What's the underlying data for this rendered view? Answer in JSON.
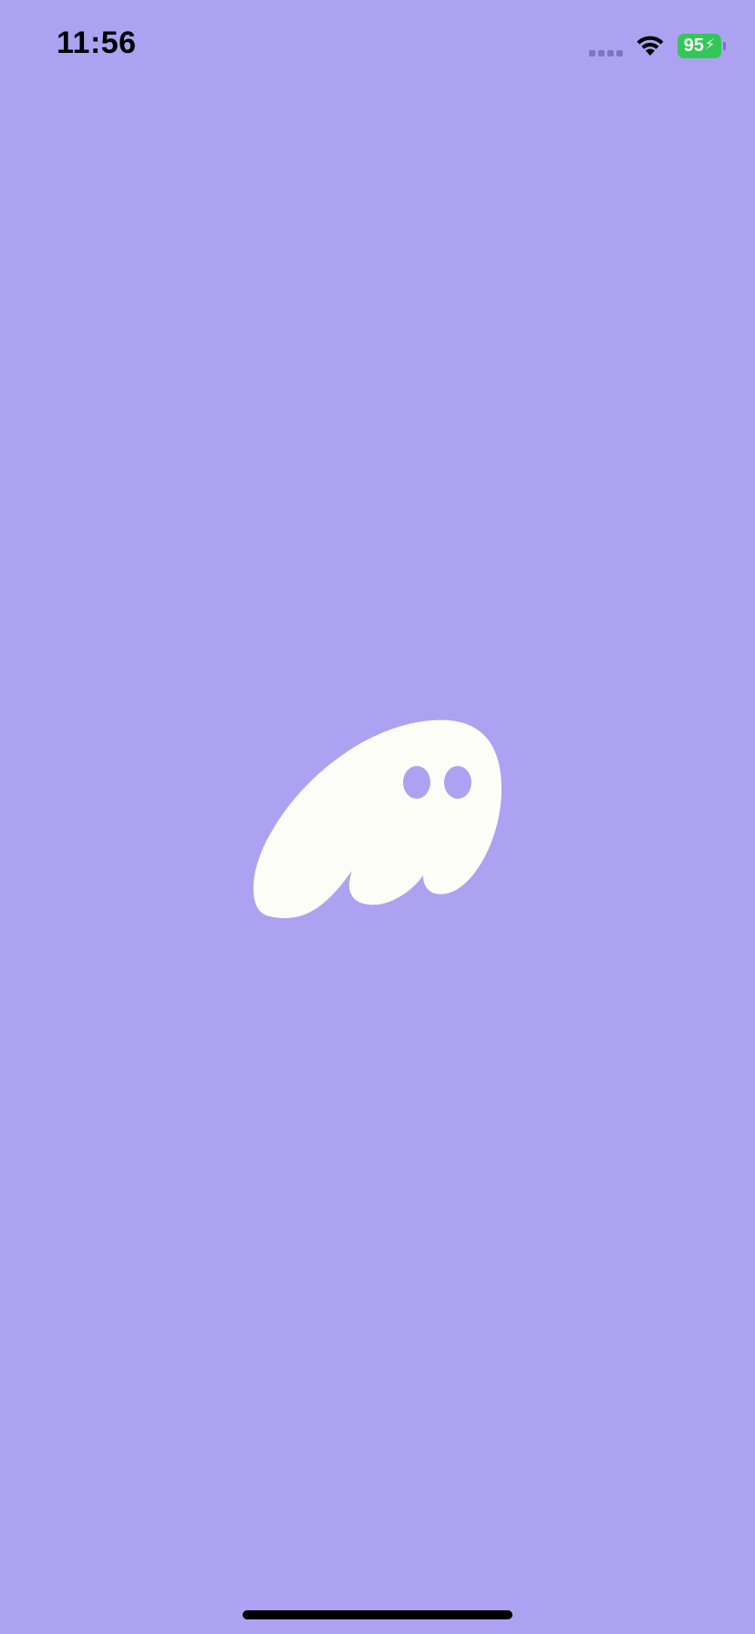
{
  "app": {
    "background_color": "#ada2f2",
    "accent_color": "#fdfdf8"
  },
  "status_bar": {
    "time": "11:56",
    "battery_level": "95",
    "battery_color": "#33c759",
    "charging": true,
    "wifi_icon": "wifi-icon",
    "signal_icon": "cellular-signal-icon",
    "charging_icon": "bolt-icon"
  },
  "splash": {
    "logo_icon": "ghost-logo-icon"
  }
}
